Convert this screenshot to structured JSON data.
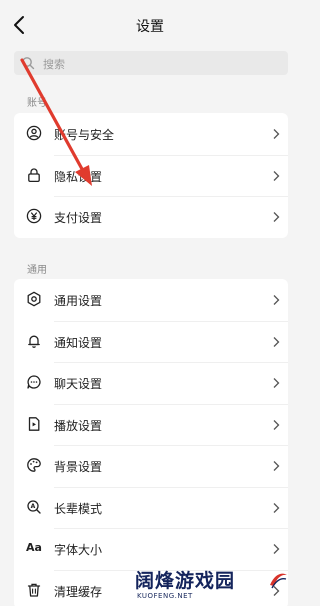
{
  "header": {
    "title": "设置"
  },
  "search": {
    "placeholder": "搜索"
  },
  "sections": {
    "account": {
      "label": "账号",
      "items": [
        {
          "label": "账号与安全",
          "icon": "user-circle-icon"
        },
        {
          "label": "隐私设置",
          "icon": "lock-icon"
        },
        {
          "label": "支付设置",
          "icon": "yen-circle-icon"
        }
      ]
    },
    "general": {
      "label": "通用",
      "items": [
        {
          "label": "通用设置",
          "icon": "gear-icon"
        },
        {
          "label": "通知设置",
          "icon": "bell-icon"
        },
        {
          "label": "聊天设置",
          "icon": "chat-bubble-icon"
        },
        {
          "label": "播放设置",
          "icon": "play-icon"
        },
        {
          "label": "背景设置",
          "icon": "palette-icon"
        },
        {
          "label": "长辈模式",
          "icon": "elder-icon"
        },
        {
          "label": "字体大小",
          "icon": "font-size-icon",
          "icon_text": "Aa"
        },
        {
          "label": "清理缓存",
          "icon": "trash-icon"
        }
      ]
    }
  },
  "watermark": {
    "main": "阔烽游戏园",
    "sub": "KUOFENG.NET"
  },
  "annotation": {
    "color": "#e03b2e"
  }
}
